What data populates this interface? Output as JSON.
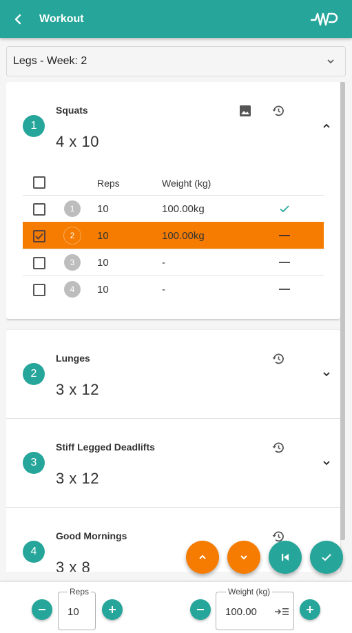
{
  "app": {
    "title": "Workout",
    "logo_text": "WP"
  },
  "workout_select": {
    "value": "Legs - Week: 2"
  },
  "exercises": [
    {
      "number": "1",
      "name": "Squats",
      "sets": "4 x 10"
    },
    {
      "number": "2",
      "name": "Lunges",
      "sets": "3 x 12"
    },
    {
      "number": "3",
      "name": "Stiff Legged Deadlifts",
      "sets": "3 x 12"
    },
    {
      "number": "4",
      "name": "Good Mornings",
      "sets": "3 x 8"
    }
  ],
  "sets_table": {
    "headers": {
      "reps": "Reps",
      "weight": "Weight (kg)"
    },
    "rows": [
      {
        "set": "1",
        "reps": "10",
        "weight": "100.00kg",
        "checked": false,
        "status": "done"
      },
      {
        "set": "2",
        "reps": "10",
        "weight": "100.00kg",
        "checked": true,
        "status": "pending"
      },
      {
        "set": "3",
        "reps": "10",
        "weight": "-",
        "checked": false,
        "status": "pending"
      },
      {
        "set": "4",
        "reps": "10",
        "weight": "-",
        "checked": false,
        "status": "pending"
      }
    ]
  },
  "inputs": {
    "reps": {
      "label": "Reps",
      "value": "10"
    },
    "weight": {
      "label": "Weight (kg)",
      "value": "100.00"
    }
  },
  "colors": {
    "primary": "#26a69a",
    "accent": "#f57c00"
  }
}
